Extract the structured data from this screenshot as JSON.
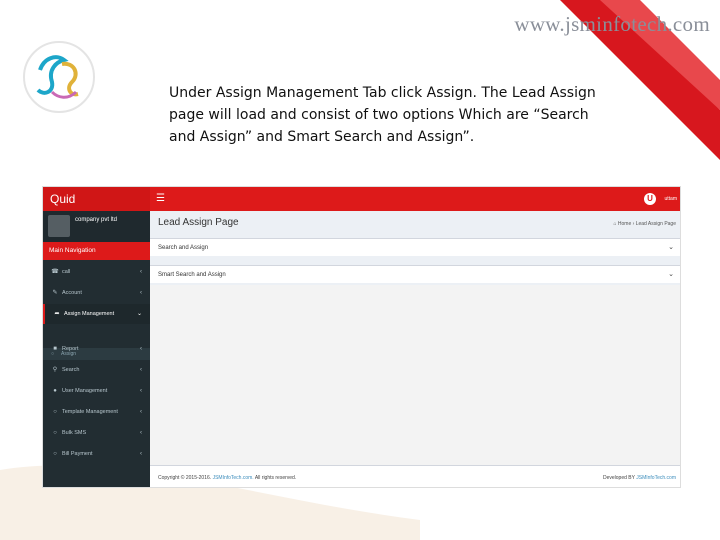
{
  "slide": {
    "site_url": "www.jsminfotech.com",
    "caption": "Under Assign Management Tab click Assign. The Lead Assign page will load and consist of two options Which are “Search and Assign” and Smart Search and Assign”.",
    "colors": {
      "ribbon": "#d7171e",
      "brand_red": "#dd1a1a",
      "sidebar_bg": "#222d32"
    }
  },
  "app": {
    "brand": "Quid",
    "menu_icon": "hamburger-icon",
    "user_initial": "U",
    "user_name": "uttam",
    "sidebar": {
      "company": "company pvt ltd",
      "nav_header": "Main Navigation",
      "items": [
        {
          "label": "call",
          "icon": "phone-icon"
        },
        {
          "label": "Account",
          "icon": "edit-icon"
        },
        {
          "label": "Assign Management",
          "icon": "share-icon",
          "active": true
        },
        {
          "label": "Report",
          "icon": "folder-icon"
        },
        {
          "label": "Search",
          "icon": "search-icon"
        },
        {
          "label": "User Management",
          "icon": "users-icon"
        },
        {
          "label": "Template Management",
          "icon": "circle-icon"
        },
        {
          "label": "Bulk SMS",
          "icon": "circle-icon"
        },
        {
          "label": "Bill Payment",
          "icon": "circle-icon"
        }
      ],
      "sub_item": "Assign"
    },
    "page_title": "Lead Assign Page",
    "breadcrumb": {
      "home": "Home",
      "current": "Lead Assign Page"
    },
    "panels": [
      "Search and Assign",
      "Smart Search and Assign"
    ],
    "footer": {
      "copyright_prefix": "Copyright © 2015-2016.",
      "copyright_link": "JSMInfoTech.com.",
      "copyright_suffix": "All rights reserved.",
      "developed_prefix": "Developed BY",
      "developed_link": "JSMInfoTech.com"
    }
  }
}
